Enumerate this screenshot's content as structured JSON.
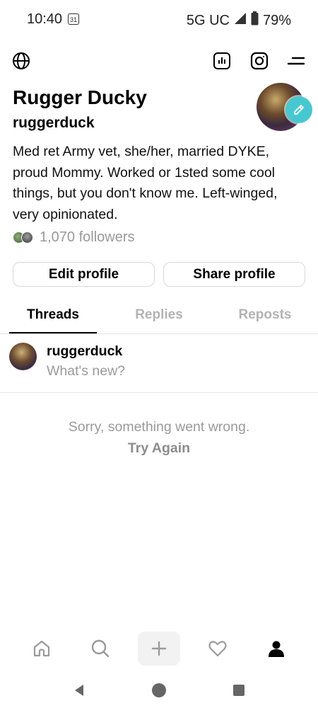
{
  "status_bar": {
    "time": "10:40",
    "calendar_day": "31",
    "network": "5G UC",
    "battery": "79%"
  },
  "profile": {
    "name": "Rugger Ducky",
    "handle": "ruggerduck",
    "bio": "Med ret Army vet, she/her, married DYKE, proud Mommy. Worked or 1sted some cool things, but you don't know me. Left-winged, very opinionated.",
    "followers": "1,070 followers"
  },
  "buttons": {
    "edit": "Edit profile",
    "share": "Share profile"
  },
  "tabs": [
    {
      "label": "Threads",
      "active": true
    },
    {
      "label": "Replies",
      "active": false
    },
    {
      "label": "Reposts",
      "active": false
    }
  ],
  "composer": {
    "handle": "ruggerduck",
    "placeholder": "What's new?"
  },
  "error": {
    "message": "Sorry, something went wrong.",
    "retry": "Try Again"
  },
  "icons": {
    "top_left": "globe-icon",
    "top_right": [
      "insights-icon",
      "instagram-icon",
      "menu-icon"
    ],
    "bottom_nav": [
      "home-icon",
      "search-icon",
      "create-icon",
      "activity-icon",
      "profile-icon"
    ],
    "system_nav": [
      "back-icon",
      "home-circle-icon",
      "recents-icon"
    ]
  },
  "colors": {
    "accent_edit": "#47c8d0",
    "muted_text": "#9a9a9a",
    "inactive_tab": "#b3b3b3"
  }
}
